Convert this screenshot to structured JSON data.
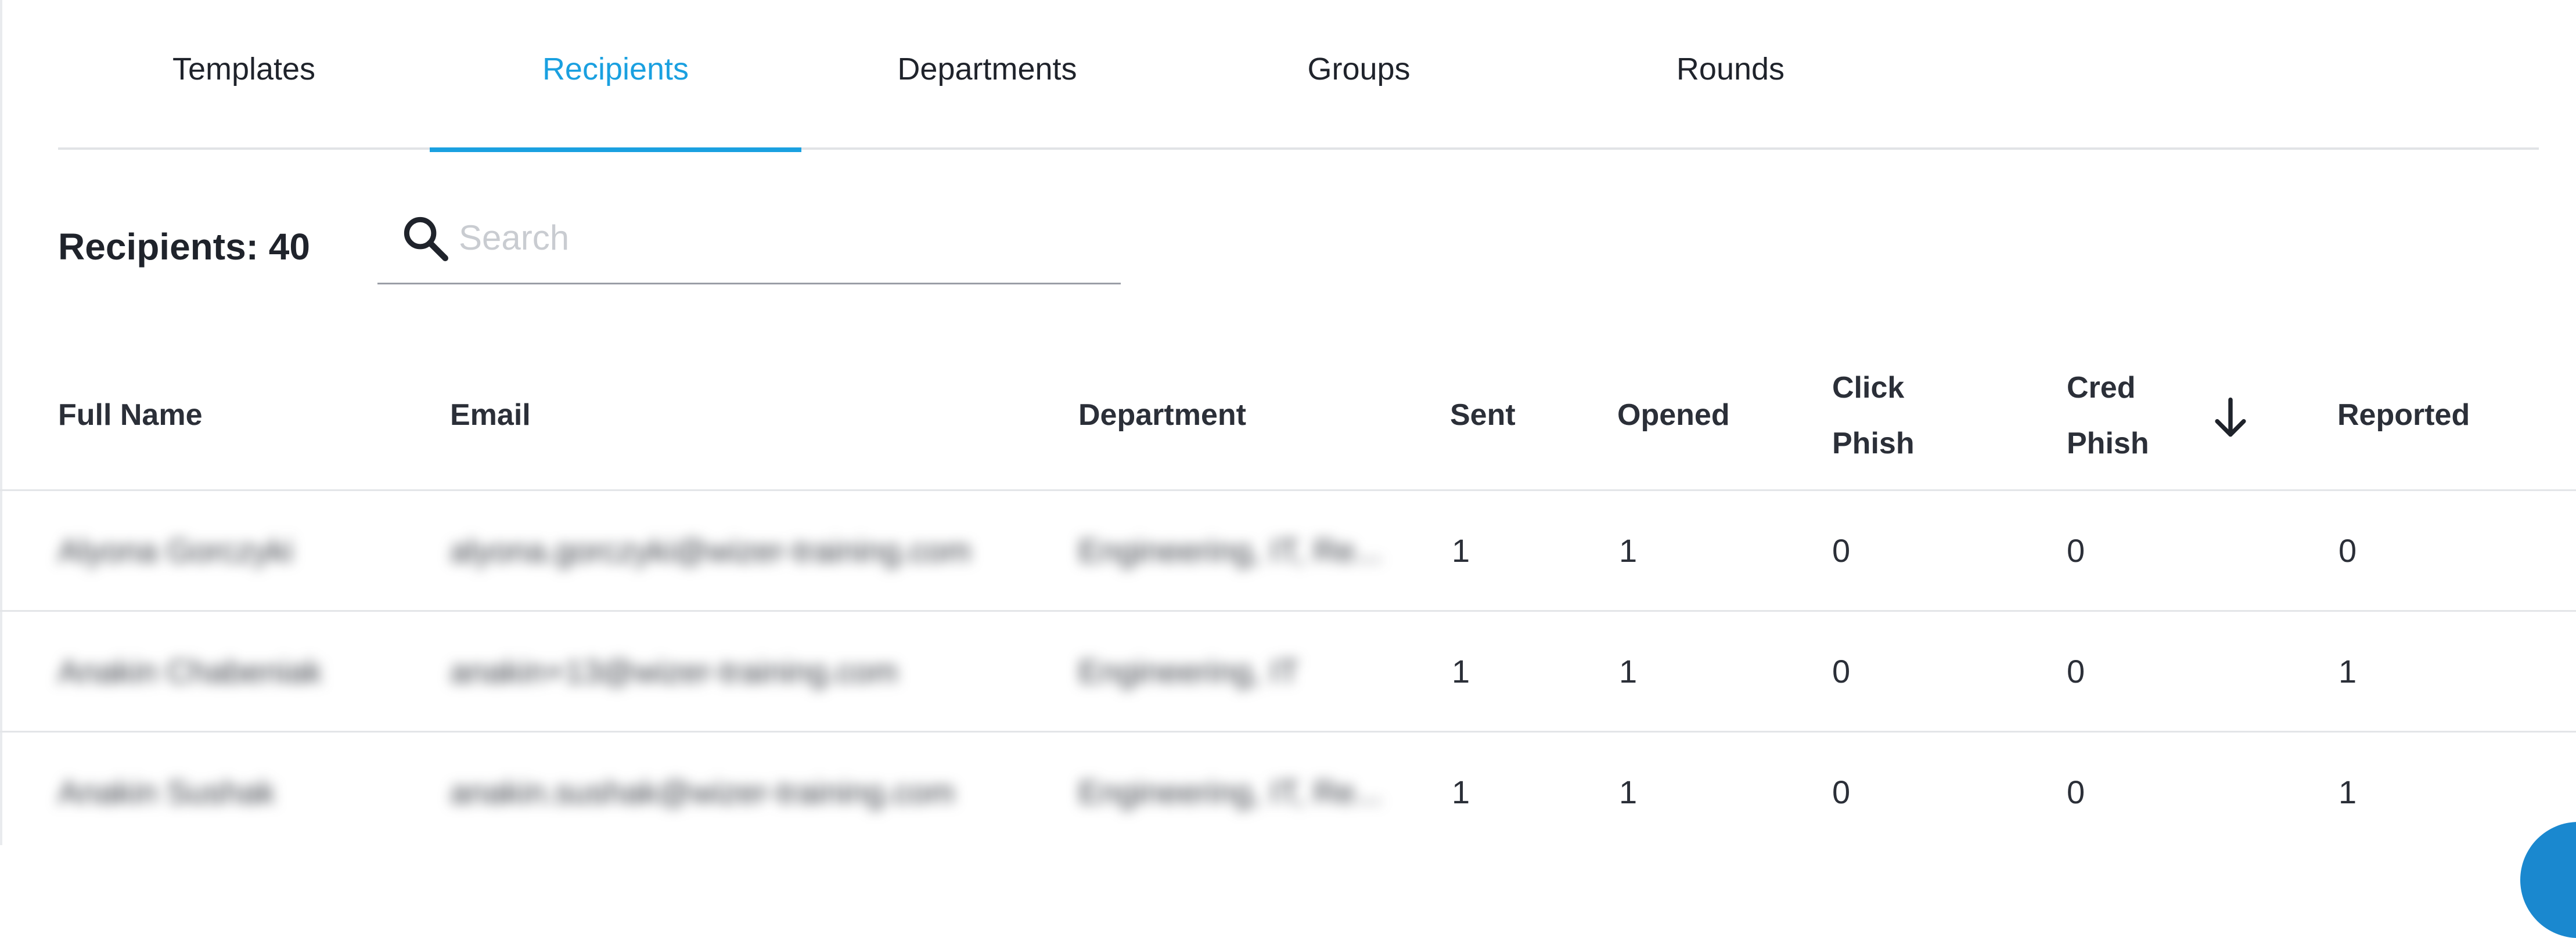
{
  "tabs": [
    {
      "label": "Templates",
      "active": false
    },
    {
      "label": "Recipients",
      "active": true
    },
    {
      "label": "Departments",
      "active": false
    },
    {
      "label": "Groups",
      "active": false
    },
    {
      "label": "Rounds",
      "active": false
    }
  ],
  "toolbar": {
    "count_label": "Recipients: 40",
    "search": {
      "placeholder": "Search",
      "value": "",
      "icon": "search-icon"
    }
  },
  "table": {
    "columns": {
      "full_name": "Full Name",
      "email": "Email",
      "department": "Department",
      "sent": "Sent",
      "opened": "Opened",
      "click_phish_1": "Click",
      "click_phish_2": "Phish",
      "cred_phish_1": "Cred",
      "cred_phish_2": "Phish",
      "reported": "Reported"
    },
    "sort": {
      "column": "Cred Phish",
      "direction": "descending",
      "icon": "arrow-down-icon"
    },
    "rows": [
      {
        "name": "Alyona Gorczyki",
        "email": "alyona.gorczyki@wizer-training.com",
        "department": "Engineering, IT, Re...",
        "sent": "1",
        "opened": "1",
        "click_phish": "0",
        "cred_phish": "0",
        "reported": "0"
      },
      {
        "name": "Anakin Chabeniak",
        "email": "anakin+13@wizer-training.com",
        "department": "Engineering, IT",
        "sent": "1",
        "opened": "1",
        "click_phish": "0",
        "cred_phish": "0",
        "reported": "1"
      },
      {
        "name": "Anakin Sushak",
        "email": "anakin.sushak@wizer-training.com",
        "department": "Engineering, IT, Re...",
        "sent": "1",
        "opened": "1",
        "click_phish": "0",
        "cred_phish": "0",
        "reported": "1"
      }
    ]
  },
  "colors": {
    "accent": "#1aa0e0",
    "text": "#2b2f38",
    "divider": "#e3e5e8",
    "placeholder": "#c9ccd1"
  }
}
